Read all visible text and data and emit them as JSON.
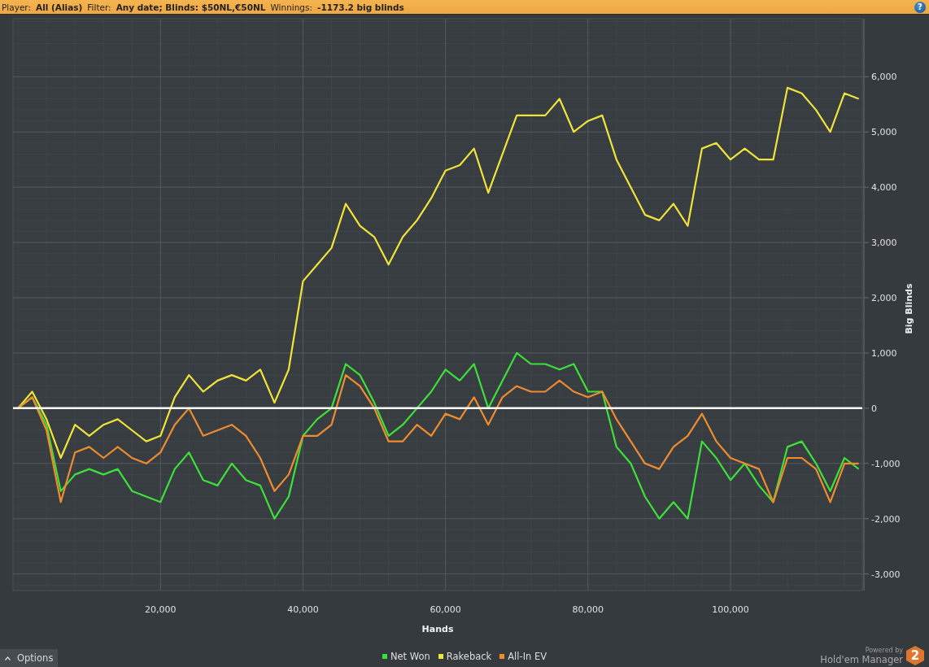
{
  "header": {
    "items": [
      {
        "label": "Player:",
        "value": "All (Alias)"
      },
      {
        "label": "Filter:",
        "value": "Any date; Blinds: $50NL,€50NL"
      },
      {
        "label": "Winnings:",
        "value": "-1173.2 big blinds"
      }
    ],
    "help": "?"
  },
  "chart": {
    "chart_data": {
      "type": "line",
      "xlabel": "Hands",
      "ylabel": "Big Blinds",
      "xlim": [
        -700,
        118500
      ],
      "ylim": [
        -3300,
        7050
      ],
      "xticks": [
        {
          "value": 20000,
          "label": "20,000"
        },
        {
          "value": 40000,
          "label": "40,000"
        },
        {
          "value": 60000,
          "label": "60,000"
        },
        {
          "value": 80000,
          "label": "80,000"
        },
        {
          "value": 100000,
          "label": "100,000"
        }
      ],
      "yticks": [
        {
          "value": -3000,
          "label": "-3,000"
        },
        {
          "value": -2000,
          "label": "-2,000"
        },
        {
          "value": -1000,
          "label": "-1,000"
        },
        {
          "value": 0,
          "label": "0"
        },
        {
          "value": 1000,
          "label": "1,000"
        },
        {
          "value": 2000,
          "label": "2,000"
        },
        {
          "value": 3000,
          "label": "3,000"
        },
        {
          "value": 4000,
          "label": "4,000"
        },
        {
          "value": 5000,
          "label": "5,000"
        },
        {
          "value": 6000,
          "label": "6,000"
        }
      ],
      "x": [
        0,
        2000,
        4000,
        6000,
        8000,
        10000,
        12000,
        14000,
        16000,
        18000,
        20000,
        22000,
        24000,
        26000,
        28000,
        30000,
        32000,
        34000,
        36000,
        38000,
        40000,
        42000,
        44000,
        46000,
        48000,
        50000,
        52000,
        54000,
        56000,
        58000,
        60000,
        62000,
        64000,
        66000,
        68000,
        70000,
        72000,
        74000,
        76000,
        78000,
        80000,
        82000,
        84000,
        86000,
        88000,
        90000,
        92000,
        94000,
        96000,
        98000,
        100000,
        102000,
        104000,
        106000,
        108000,
        110000,
        112000,
        114000,
        116000,
        118000
      ],
      "grid": true,
      "legend": "bottom",
      "series": [
        {
          "name": "Net Won",
          "color": "#3ee03a",
          "values": [
            0,
            200,
            -300,
            -1500,
            -1200,
            -1100,
            -1200,
            -1100,
            -1500,
            -1600,
            -1700,
            -1100,
            -800,
            -1300,
            -1400,
            -1000,
            -1300,
            -1400,
            -2000,
            -1600,
            -500,
            -200,
            0,
            800,
            600,
            100,
            -500,
            -300,
            0,
            300,
            700,
            500,
            800,
            0,
            500,
            1000,
            800,
            800,
            700,
            800,
            300,
            300,
            -700,
            -1000,
            -1600,
            -2000,
            -1700,
            -2000,
            -600,
            -900,
            -1300,
            -1000,
            -1400,
            -1700,
            -700,
            -600,
            -1000,
            -1500,
            -900,
            -1100
          ]
        },
        {
          "name": "Rakeback",
          "color": "#f0e43a",
          "values": [
            0,
            300,
            -200,
            -900,
            -300,
            -500,
            -300,
            -200,
            -400,
            -600,
            -500,
            200,
            600,
            300,
            500,
            600,
            500,
            700,
            100,
            700,
            2300,
            2600,
            2900,
            3700,
            3300,
            3100,
            2600,
            3100,
            3400,
            3800,
            4300,
            4400,
            4700,
            3900,
            4600,
            5300,
            5300,
            5300,
            5600,
            5000,
            5200,
            5300,
            4500,
            4000,
            3500,
            3400,
            3700,
            3300,
            4700,
            4800,
            4500,
            4700,
            4500,
            4500,
            5800,
            5700,
            5400,
            5000,
            5700,
            5600
          ]
        },
        {
          "name": "All-In EV",
          "color": "#f08c30",
          "values": [
            0,
            200,
            -400,
            -1700,
            -800,
            -700,
            -900,
            -700,
            -900,
            -1000,
            -800,
            -300,
            0,
            -500,
            -400,
            -300,
            -500,
            -900,
            -1500,
            -1200,
            -500,
            -500,
            -300,
            600,
            400,
            0,
            -600,
            -600,
            -300,
            -500,
            -100,
            -200,
            200,
            -300,
            200,
            400,
            300,
            300,
            500,
            300,
            200,
            300,
            -200,
            -600,
            -1000,
            -1100,
            -700,
            -500,
            -100,
            -600,
            -900,
            -1000,
            -1100,
            -1700,
            -900,
            -900,
            -1100,
            -1700,
            -1000,
            -1000
          ]
        }
      ]
    }
  },
  "options_button": "Options",
  "brand": {
    "powered_by": "Powered by",
    "name": "Hold'em Manager",
    "logo": "2"
  }
}
